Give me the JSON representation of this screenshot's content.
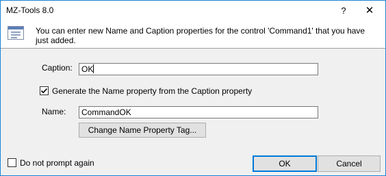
{
  "window": {
    "title": "MZ-Tools 8.0",
    "help_glyph": "?",
    "close_glyph": "✕"
  },
  "header": {
    "icon": "form-icon",
    "message": "You can enter new Name and Caption properties for the control 'Command1' that you have just added."
  },
  "form": {
    "caption_label": "Caption:",
    "caption_value": "OK",
    "generate_checkbox_label": "Generate the Name property from the Caption property",
    "generate_checked": true,
    "name_label": "Name:",
    "name_value": "CommandOK",
    "change_tag_button": "Change Name Property Tag..."
  },
  "footer": {
    "do_not_prompt_label": "Do not prompt again",
    "do_not_prompt_checked": false,
    "ok_button": "OK",
    "cancel_button": "Cancel"
  },
  "colors": {
    "window_border": "#1883d7",
    "default_button_border": "#0078d7",
    "dialog_background": "#f0f0f0"
  }
}
